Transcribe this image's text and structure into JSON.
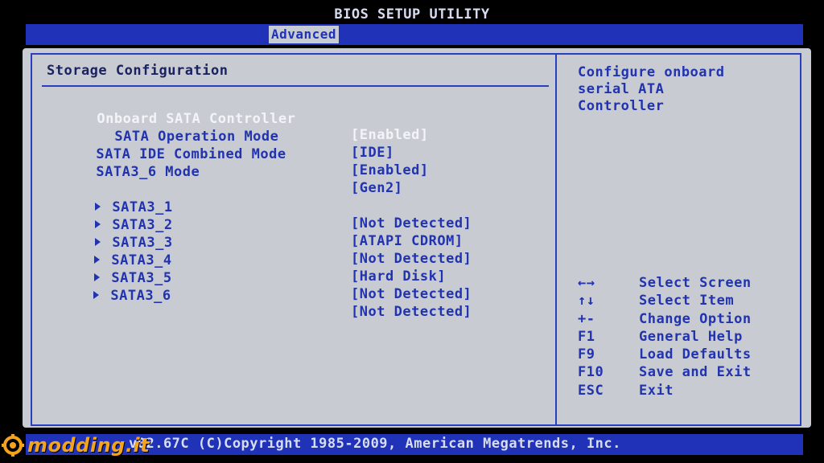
{
  "title": "BIOS SETUP UTILITY",
  "active_tab": "Advanced",
  "section_title": "Storage Configuration",
  "settings": [
    {
      "label": "Onboard SATA Controller",
      "value": "[Enabled]",
      "indent": false,
      "highlight": true
    },
    {
      "label": "SATA Operation Mode",
      "value": "[IDE]",
      "indent": true,
      "highlight": false
    },
    {
      "label": "SATA IDE Combined Mode",
      "value": "[Enabled]",
      "indent": false,
      "highlight": false
    },
    {
      "label": "SATA3_6 Mode",
      "value": "[Gen2]",
      "indent": false,
      "highlight": false
    }
  ],
  "ports": [
    {
      "label": "SATA3_1",
      "value": "[Not Detected]"
    },
    {
      "label": "SATA3_2",
      "value": "[ATAPI CDROM]"
    },
    {
      "label": "SATA3_3",
      "value": "[Not Detected]"
    },
    {
      "label": "SATA3_4",
      "value": "[Hard Disk]"
    },
    {
      "label": "SATA3_5",
      "value": "[Not Detected]"
    },
    {
      "label": "SATA3_6",
      "value": "[Not Detected]"
    }
  ],
  "help_text": [
    "Configure onboard",
    "serial ATA",
    "Controller"
  ],
  "key_help": [
    {
      "key": "←→",
      "desc": "Select Screen"
    },
    {
      "key": "↑↓",
      "desc": "Select Item"
    },
    {
      "key": "+-",
      "desc": "Change Option"
    },
    {
      "key": "F1",
      "desc": "General Help"
    },
    {
      "key": "F9",
      "desc": "Load Defaults"
    },
    {
      "key": "F10",
      "desc": "Save and Exit"
    },
    {
      "key": "ESC",
      "desc": "Exit"
    }
  ],
  "copyright": "v02.67C (C)Copyright 1985-2009, American Megatrends, Inc.",
  "watermark": "modding.it",
  "colors": {
    "bar_blue": "#1f32b8",
    "panel_gray": "#c8ccd2",
    "text_blue": "#2233b0",
    "highlight_white": "#f2f4f8",
    "watermark_orange": "#f3a41c"
  }
}
